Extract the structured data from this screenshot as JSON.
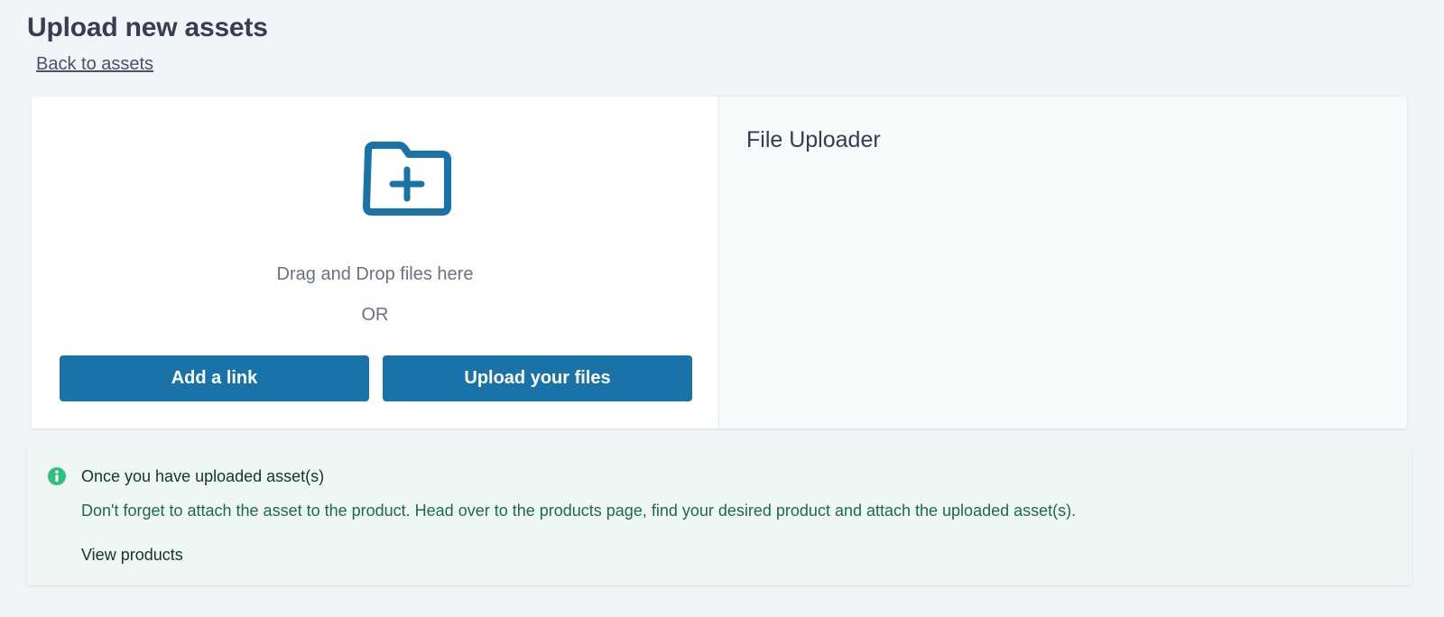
{
  "header": {
    "title": "Upload new assets",
    "back_link": "Back to assets"
  },
  "dropzone": {
    "icon": "folder-plus-icon",
    "drag_text": "Drag and Drop files here",
    "or_text": "OR",
    "add_link_label": "Add a link",
    "upload_files_label": "Upload your files"
  },
  "uploader": {
    "title": "File Uploader"
  },
  "info": {
    "icon": "info-icon",
    "heading": "Once you have uploaded asset(s)",
    "body": "Don't forget to attach the asset to the product. Head over to the products page, find your desired product and attach the uploaded asset(s).",
    "link": "View products"
  },
  "colors": {
    "accent": "#1a73a8",
    "info_icon": "#2fbf7f",
    "info_bg": "#eff7f4"
  }
}
